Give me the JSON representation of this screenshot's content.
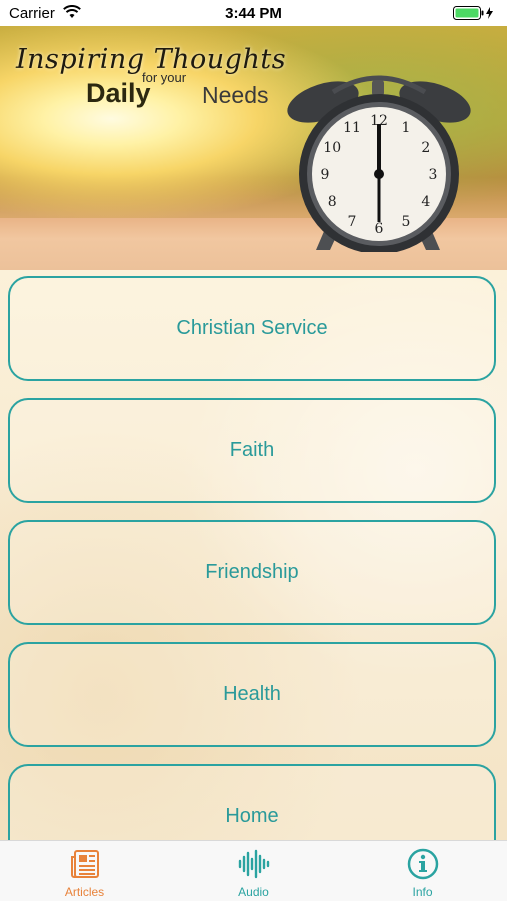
{
  "status_bar": {
    "carrier": "Carrier",
    "time": "3:44 PM",
    "wifi_icon": "wifi-icon",
    "battery_icon": "battery-charging-icon"
  },
  "header": {
    "title_line1": "Inspiring Thoughts",
    "title_small": "for your",
    "title_daily": "Daily",
    "title_needs": "Needs",
    "clock_numbers": [
      "12",
      "1",
      "2",
      "3",
      "4",
      "5",
      "6",
      "7",
      "8",
      "9",
      "10",
      "11"
    ]
  },
  "categories": [
    {
      "label": "Christian Service"
    },
    {
      "label": "Faith"
    },
    {
      "label": "Friendship"
    },
    {
      "label": "Health"
    },
    {
      "label": "Home"
    }
  ],
  "tabs": [
    {
      "label": "Articles",
      "icon": "newspaper-icon",
      "active": true
    },
    {
      "label": "Audio",
      "icon": "audio-waveform-icon",
      "active": false
    },
    {
      "label": "Info",
      "icon": "info-icon",
      "active": false
    }
  ],
  "colors": {
    "accent_teal": "#2ba3a1",
    "active_orange": "#e8823a"
  }
}
